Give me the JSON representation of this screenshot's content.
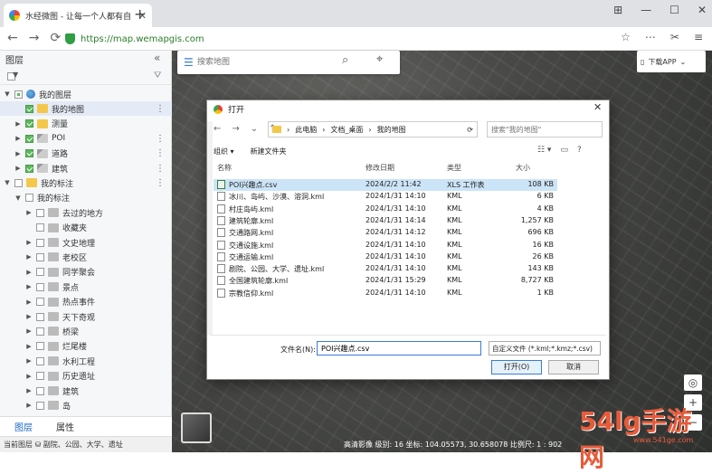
{
  "browser": {
    "tab_title": "水经微图 - 让每一个人都有自",
    "url": "https://map.wemapgis.com",
    "nav": {
      "back": "←",
      "forward": "→",
      "reload": "⟳"
    },
    "window_controls": [
      "⊞",
      "—",
      "☐",
      "✕"
    ],
    "tools": [
      "☆",
      "⋯",
      "✂",
      "≡"
    ]
  },
  "left_panel": {
    "title": "图层",
    "collapse": "«",
    "tree": [
      {
        "label": "我的图层",
        "level": 0,
        "checked": "partial",
        "icon": "globe-icon",
        "caret": "▼"
      },
      {
        "label": "我的地图",
        "level": 1,
        "checked": "on",
        "icon": "folder-icon",
        "caret": "",
        "selected": true,
        "more": true
      },
      {
        "label": "测量",
        "level": 1,
        "checked": "on",
        "icon": "folder-icon",
        "caret": "▶"
      },
      {
        "label": "POI",
        "level": 1,
        "checked": "on",
        "icon": "layer-icon",
        "caret": "▶",
        "more": true
      },
      {
        "label": "道路",
        "level": 1,
        "checked": "on",
        "icon": "layer-icon",
        "caret": "▶",
        "more": true
      },
      {
        "label": "建筑",
        "level": 1,
        "checked": "on",
        "icon": "layer-icon",
        "caret": "▶",
        "more": true
      },
      {
        "label": "我的标注",
        "level": 0,
        "checked": "off",
        "icon": "folder-icon",
        "caret": "▼",
        "more": true
      },
      {
        "label": "我的标注",
        "level": 1,
        "checked": "off",
        "icon": "",
        "caret": "▼"
      },
      {
        "label": "去过的地方",
        "level": 2,
        "checked": "off",
        "icon": "folder-g-icon",
        "caret": "▶"
      },
      {
        "label": "收藏夹",
        "level": 2,
        "checked": "off",
        "icon": "folder-g-icon",
        "caret": ""
      },
      {
        "label": "文史地理",
        "level": 2,
        "checked": "off",
        "icon": "folder-g-icon",
        "caret": "▶"
      },
      {
        "label": "老校区",
        "level": 2,
        "checked": "off",
        "icon": "folder-g-icon",
        "caret": "▶"
      },
      {
        "label": "同学聚会",
        "level": 2,
        "checked": "off",
        "icon": "folder-g-icon",
        "caret": "▶"
      },
      {
        "label": "景点",
        "level": 2,
        "checked": "off",
        "icon": "folder-g-icon",
        "caret": "▶"
      },
      {
        "label": "热点事件",
        "level": 2,
        "checked": "off",
        "icon": "folder-g-icon",
        "caret": "▶"
      },
      {
        "label": "天下奇观",
        "level": 2,
        "checked": "off",
        "icon": "folder-g-icon",
        "caret": "▶"
      },
      {
        "label": "桥梁",
        "level": 2,
        "checked": "off",
        "icon": "folder-g-icon",
        "caret": "▶"
      },
      {
        "label": "烂尾楼",
        "level": 2,
        "checked": "off",
        "icon": "folder-g-icon",
        "caret": "▶"
      },
      {
        "label": "水利工程",
        "level": 2,
        "checked": "off",
        "icon": "folder-g-icon",
        "caret": "▶"
      },
      {
        "label": "历史遗址",
        "level": 2,
        "checked": "off",
        "icon": "folder-g-icon",
        "caret": "▶"
      },
      {
        "label": "建筑",
        "level": 2,
        "checked": "off",
        "icon": "folder-g-icon",
        "caret": "▶"
      },
      {
        "label": "岛",
        "level": 2,
        "checked": "off",
        "icon": "folder-g-icon",
        "caret": "▶"
      }
    ],
    "tabs": {
      "layers": "图层",
      "props": "属性"
    },
    "status": "当前图层  ⛁ 副院、公园、大学、遗址"
  },
  "map": {
    "search_placeholder": "搜索地图",
    "download_app": "下载APP",
    "zoom_in": "+",
    "zoom_out": "−",
    "locate": "◎",
    "status": "高清影像    级别: 16    坐标:       104.05573, 30.658078    比例尺: 1 : 902",
    "watermark": "54lg手游网",
    "watermark_sub": "www.541ge.com"
  },
  "dialog": {
    "title": "打开",
    "close": "✕",
    "path": [
      "此电脑",
      "文档_桌面",
      "我的地图"
    ],
    "search_placeholder": "搜索\"我的地图\"",
    "toolbar": {
      "organize": "组织 ▾",
      "new_folder": "新建文件夹"
    },
    "columns": {
      "name": "名称",
      "date": "修改日期",
      "type": "类型",
      "size": "大小"
    },
    "files": [
      {
        "name": "POI兴趣点.csv",
        "date": "2024/2/2 11:42",
        "type": "XLS 工作表",
        "size": "108 KB",
        "selected": true,
        "kind": "csv"
      },
      {
        "name": "冰川、岛屿、沙漠、溶洞.kml",
        "date": "2024/1/31 14:10",
        "type": "KML",
        "size": "6 KB",
        "kind": "kml"
      },
      {
        "name": "村庄岛屿.kml",
        "date": "2024/1/31 14:10",
        "type": "KML",
        "size": "4 KB",
        "kind": "kml"
      },
      {
        "name": "建筑轮廓.kml",
        "date": "2024/1/31 14:14",
        "type": "KML",
        "size": "1,257 KB",
        "kind": "kml"
      },
      {
        "name": "交通路网.kml",
        "date": "2024/1/31 14:12",
        "type": "KML",
        "size": "696 KB",
        "kind": "kml"
      },
      {
        "name": "交通设施.kml",
        "date": "2024/1/31 14:10",
        "type": "KML",
        "size": "16 KB",
        "kind": "kml"
      },
      {
        "name": "交通运输.kml",
        "date": "2024/1/31 14:10",
        "type": "KML",
        "size": "26 KB",
        "kind": "kml"
      },
      {
        "name": "剧院、公园、大学、遗址.kml",
        "date": "2024/1/31 14:10",
        "type": "KML",
        "size": "143 KB",
        "kind": "kml"
      },
      {
        "name": "全国建筑轮廓.kml",
        "date": "2024/1/31 15:29",
        "type": "KML",
        "size": "8,727 KB",
        "kind": "kml"
      },
      {
        "name": "宗教信仰.kml",
        "date": "2024/1/31 14:10",
        "type": "KML",
        "size": "1 KB",
        "kind": "kml"
      }
    ],
    "filename_label": "文件名(N):",
    "filename_value": "POI兴趣点.csv",
    "filetype": "自定义文件 (*.kml;*.kmz;*.csv)",
    "open": "打开(O)",
    "cancel": "取消"
  }
}
